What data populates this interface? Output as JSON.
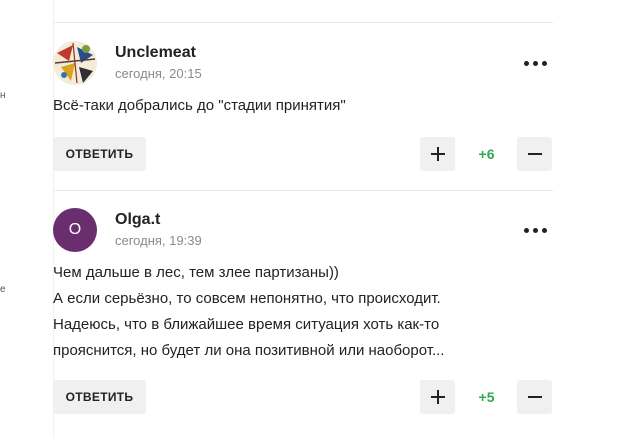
{
  "left_edge_fragments": [
    "н",
    "е"
  ],
  "comments": [
    {
      "author": "Unclemeat",
      "time": "сегодня, 20:15",
      "avatar_letter": "",
      "lines": [
        "Всё-таки добрались до \"стадии принятия\""
      ],
      "reply_label": "ОТВЕТИТЬ",
      "score": "+6",
      "upvote_glyph": "+",
      "downvote_glyph": "−"
    },
    {
      "author": "Olga.t",
      "time": "сегодня, 19:39",
      "avatar_letter": "O",
      "lines": [
        "Чем дальше в лес, тем злее партизаны))",
        "А если серьёзно, то совсем непонятно, что происходит.",
        "Надеюсь, что в ближайшее время ситуация хоть как-то",
        "прояснится, но будет ли она позитивной или наоборот..."
      ],
      "reply_label": "ОТВЕТИТЬ",
      "score": "+5",
      "upvote_glyph": "+",
      "downvote_glyph": "−"
    }
  ],
  "colors": {
    "score_positive": "#2fa84f",
    "avatar_bg": "#6a2d6e",
    "button_bg": "#f0f0f0"
  }
}
